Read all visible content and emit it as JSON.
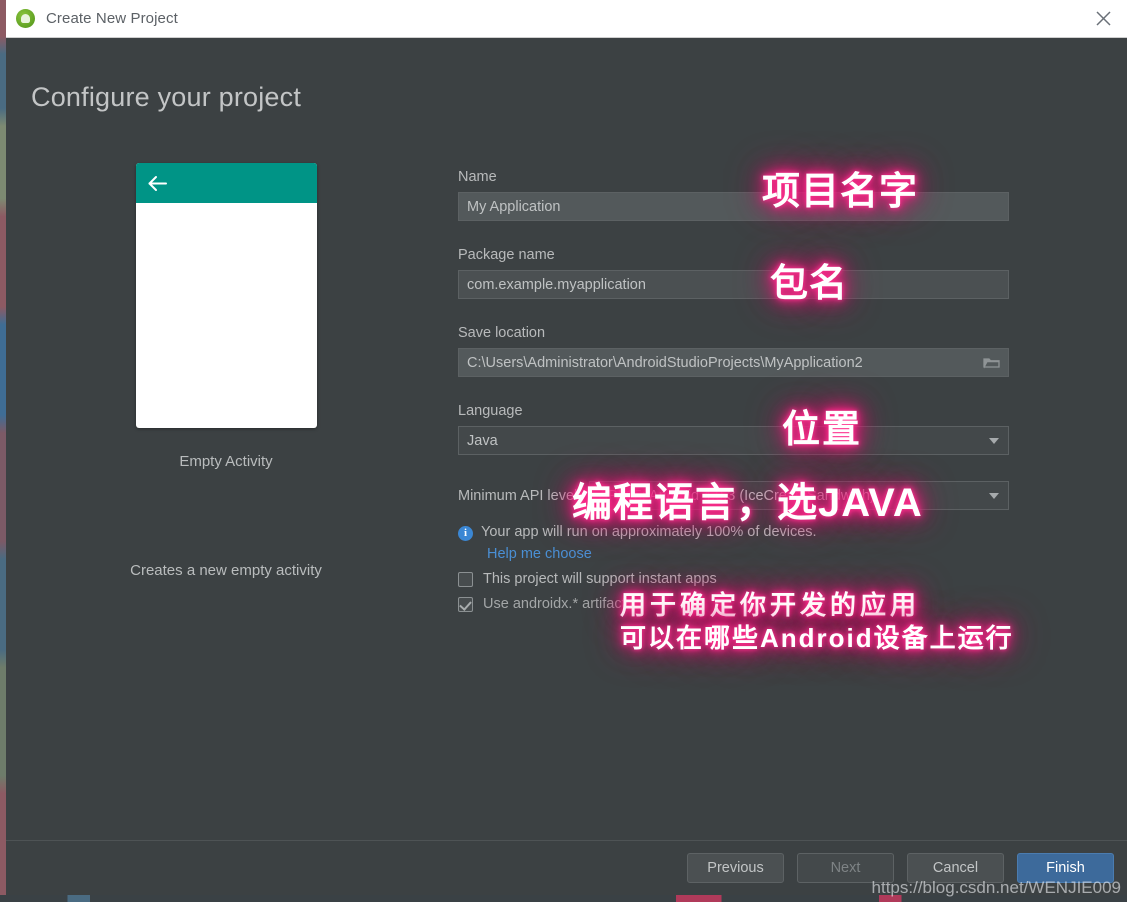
{
  "titlebar": {
    "title": "Create New Project",
    "logo_icon": "android-logo-icon",
    "close_icon": "close-icon"
  },
  "heading": "Configure your project",
  "preview": {
    "back_icon": "arrow-left-icon",
    "appbar_color": "#009486",
    "template_name": "Empty Activity",
    "template_description": "Creates a new empty activity"
  },
  "form": {
    "name": {
      "label": "Name",
      "value": "My Application"
    },
    "package": {
      "label": "Package name",
      "value": "com.example.myapplication"
    },
    "location": {
      "label": "Save location",
      "value": "C:\\Users\\Administrator\\AndroidStudioProjects\\MyApplication2",
      "browse_icon": "folder-icon"
    },
    "language": {
      "label": "Language",
      "value": "Java",
      "caret_icon": "chevron-down-icon"
    },
    "api": {
      "label": "Minimum API level",
      "value": "API 15: Android 4.0.3 (IceCreamSandwich)",
      "caret_icon": "chevron-down-icon"
    },
    "info": {
      "icon": "info-icon",
      "text": "Your app will run on approximately 100% of devices.",
      "link": "Help me choose"
    },
    "checkbox_instant_apps": {
      "label": "This project will support instant apps",
      "checked": false
    },
    "checkbox_androidx": {
      "label": "Use androidx.* artifacts",
      "checked": true
    }
  },
  "footer": {
    "previous": "Previous",
    "next": "Next",
    "cancel": "Cancel",
    "finish": "Finish",
    "finish_color": "#3d6a9b"
  },
  "watermark": "https://blog.csdn.net/WENJIE009",
  "annotations": {
    "accent_color": "#ff2f8e",
    "name": "项目名字",
    "package": "包名",
    "location": "位置",
    "language": "编程语言，选JAVA",
    "api_line1": "用于确定你开发的应用",
    "api_line2": "可以在哪些Android设备上运行"
  }
}
